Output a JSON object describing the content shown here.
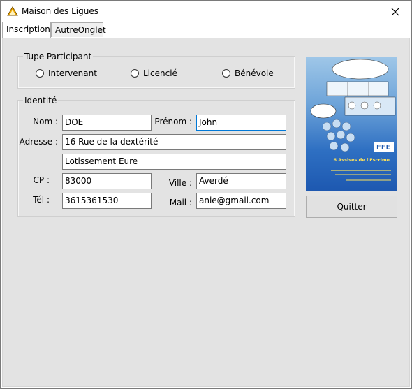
{
  "window": {
    "title": "Maison des Ligues",
    "icon": "triangle-logo-icon",
    "close_icon": "close-icon"
  },
  "tabs": [
    {
      "label": "Inscription",
      "active": true
    },
    {
      "label": "AutreOnglet",
      "active": false
    }
  ],
  "participant_type": {
    "title": "Tupe Participant",
    "options": [
      "Intervenant",
      "Licencié",
      "Bénévole"
    ]
  },
  "identity": {
    "title": "Identité",
    "nom_label": "Nom :",
    "nom_value": "DOE",
    "prenom_label": "Prénom :",
    "prenom_value": "John",
    "adresse_label": "Adresse :",
    "adresse_line1": "16 Rue de la dextérité",
    "adresse_line2": "Lotissement Eure",
    "cp_label": "CP :",
    "cp_value": "83000",
    "ville_label": "Ville :",
    "ville_value": "Averdé",
    "tel_label": "Tél :",
    "tel_value": "3615361530",
    "mail_label": "Mail :",
    "mail_value": "anie@gmail.com"
  },
  "poster": {
    "logo": "FFE",
    "headline": "6 Assises de l'Escrime"
  },
  "buttons": {
    "quit_label": "Quitter"
  }
}
